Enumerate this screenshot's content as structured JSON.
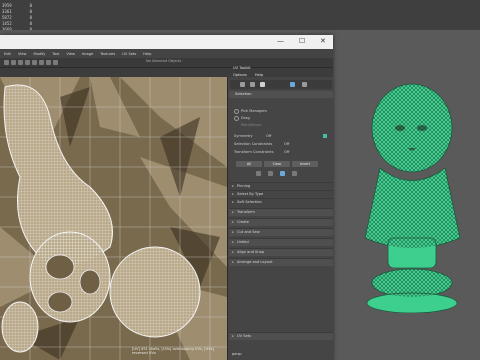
{
  "stats": {
    "rows": [
      [
        "3959",
        "0"
      ],
      [
        "3361",
        "0"
      ],
      [
        "5872",
        "0"
      ],
      [
        "1452",
        "0"
      ],
      [
        "3669",
        "0"
      ]
    ]
  },
  "uv_editor": {
    "window_controls": [
      "—",
      "☐",
      "✕"
    ],
    "menu": [
      "Edit",
      "View",
      "Modify",
      "Tool",
      "View",
      "Image",
      "Textures",
      "UV Sets",
      "Help"
    ],
    "toolbar_field": "No Selected Objects",
    "status": "[UV] 451 shells, [UVs] overlapping UVs, [UVs] reversed UVs"
  },
  "uv_toolkit": {
    "title": "UV Toolkit",
    "menu": [
      "Options",
      "Help"
    ],
    "header": "Selection",
    "pick_mode": [
      "Pick Managers",
      "Drag",
      "Paint/Brush"
    ],
    "symmetry_label": "Symmetry",
    "symmetry_value": "Off",
    "selection_constraints_label": "Selection Constraints",
    "selection_constraints_value": "Off",
    "transform_constraints_label": "Transform Constraints",
    "transform_constraints_value": "Off",
    "buttons": [
      "All",
      "Clear",
      "Invert"
    ],
    "sections": [
      "Pinning",
      "Select By Type",
      "Soft Selection",
      "Transform",
      "Create",
      "Cut and Sew",
      "Unfold",
      "Align and Snap",
      "Arrange and Layout"
    ],
    "uv_sets": "UV Sets"
  },
  "colors": {
    "accent": "#3fbfa8",
    "mesh": "#3ccf8e"
  },
  "taskbar": {
    "label": "persp"
  }
}
